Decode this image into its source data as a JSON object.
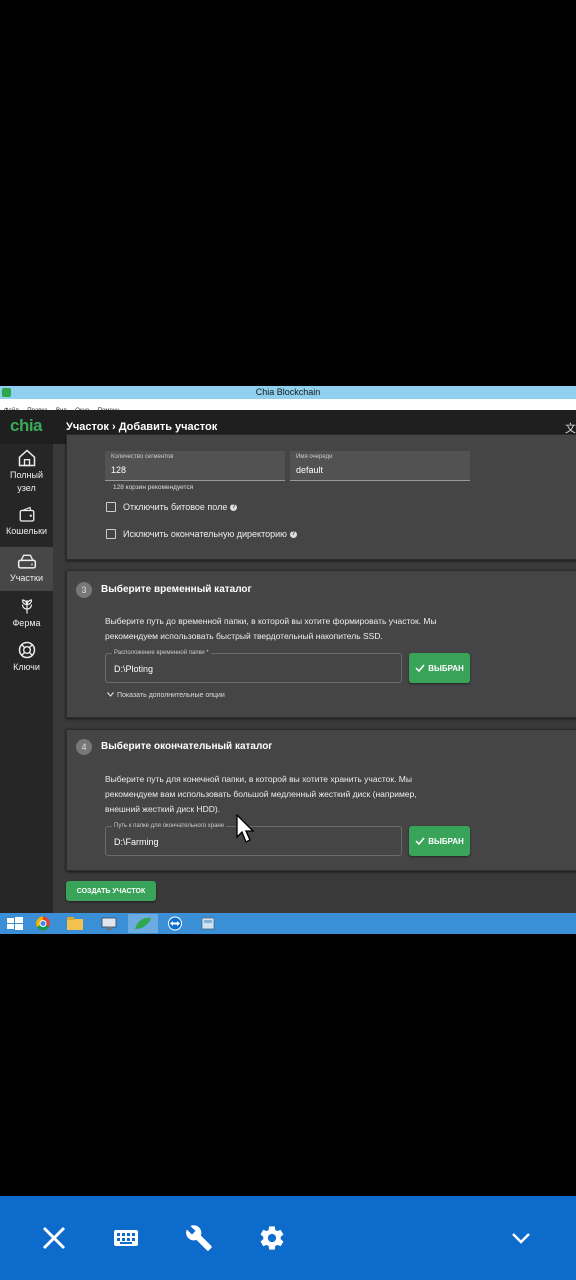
{
  "window": {
    "title": "Chia Blockchain"
  },
  "menu": [
    "Файл",
    "Правка",
    "Вид",
    "Окно",
    "Помощь"
  ],
  "app": {
    "logo": "chia",
    "breadcrumb": "Участок › Добавить участок"
  },
  "sidebar": {
    "items": [
      {
        "label_line1": "Полный",
        "label_line2": "узел",
        "icon": "home-icon"
      },
      {
        "label": "Кошельки",
        "icon": "wallet-icon"
      },
      {
        "label": "Участки",
        "icon": "plots-icon",
        "active": true
      },
      {
        "label": "Ферма",
        "icon": "farm-icon"
      },
      {
        "label": "Ключи",
        "icon": "keys-icon"
      }
    ]
  },
  "advanced": {
    "buckets_label": "Количество сегментов",
    "buckets_value": "128",
    "buckets_hint": "128 корзин рекомендуется",
    "queue_label": "Имя очереди",
    "queue_value": "default",
    "disable_bitfield": "Отключить битовое поле",
    "exclude_final_dir": "Исключить окончательную директорию"
  },
  "step3": {
    "number": "3",
    "title": "Выберите временный каталог",
    "description": "Выберите путь до временной папки, в которой вы хотите формировать участок. Мы рекомендуем использовать быстрый твердотельный накопитель SSD.",
    "field_label": "Расположение временной папки *",
    "field_value": "D:\\Ploting",
    "button_label": "ВЫБРАН",
    "more_options": "Показать дополнительные опции"
  },
  "step4": {
    "number": "4",
    "title": "Выберите окончательный каталог",
    "description": "Выберите путь для конечной папки, в которой вы хотите хранить участок. Мы рекомендуем вам использовать большой медленный жесткий диск (например, внешний жесткий диск HDD).",
    "field_label": "Путь к папке для окончательного хране",
    "field_value": "D:\\Farming",
    "button_label": "ВЫБРАН"
  },
  "create_button": "СОЗДАТЬ УЧАСТОК",
  "colors": {
    "accent": "#3aa35a",
    "titlebar": "#8fd0ee",
    "taskbar": "#3b8fd6",
    "bottombar": "#0d6bcb"
  }
}
